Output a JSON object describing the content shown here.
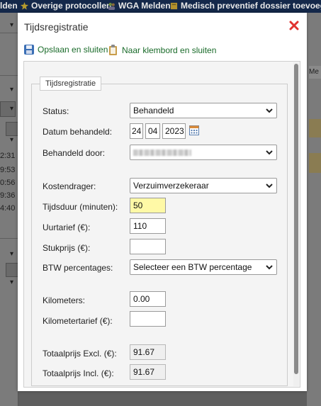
{
  "background": {
    "topbar": {
      "item1": "lden",
      "item2": "Overige protocollen",
      "item3": "WGA Melden",
      "item4": "Medisch preventief dossier toevoegen"
    },
    "times": [
      "2:31",
      "9:53",
      "0:56",
      "9:36",
      "4:40"
    ],
    "column_partial": "Me"
  },
  "dialog": {
    "title": "Tijdsregistratie",
    "close_icon": "close-x-icon",
    "toolbar": {
      "save_label": "Opslaan en sluiten",
      "save_icon": "floppy-disk-icon",
      "clipboard_label": "Naar klembord en sluiten",
      "clipboard_icon": "clipboard-icon"
    },
    "fieldset_legend": "Tijdsregistratie",
    "fields": {
      "status": {
        "label": "Status:",
        "value": "Behandeld"
      },
      "datum": {
        "label": "Datum behandeld:",
        "day": "24",
        "month": "04",
        "year": "2023",
        "icon": "calendar-icon"
      },
      "behandeld_door": {
        "label": "Behandeld door:",
        "value": ""
      },
      "kostendrager": {
        "label": "Kostendrager:",
        "value": "Verzuimverzekeraar"
      },
      "tijdsduur": {
        "label": "Tijdsduur (minuten):",
        "value": "50"
      },
      "uurtarief": {
        "label": "Uurtarief (€):",
        "value": "110"
      },
      "stukprijs": {
        "label": "Stukprijs (€):",
        "value": ""
      },
      "btw": {
        "label": "BTW percentages:",
        "value": "Selecteer een BTW percentage"
      },
      "kilometers": {
        "label": "Kilometers:",
        "value": "0.00"
      },
      "kilometertarief": {
        "label": "Kilometertarief (€):",
        "value": ""
      },
      "totaal_excl": {
        "label": "Totaalprijs Excl. (€):",
        "value": "91.67"
      },
      "totaal_incl": {
        "label": "Totaalprijs Incl. (€):",
        "value": "91.67"
      }
    },
    "colors": {
      "toolbar_text": "#1a6b2a",
      "close": "#e0322f",
      "highlight_input": "#fff9a6"
    }
  }
}
